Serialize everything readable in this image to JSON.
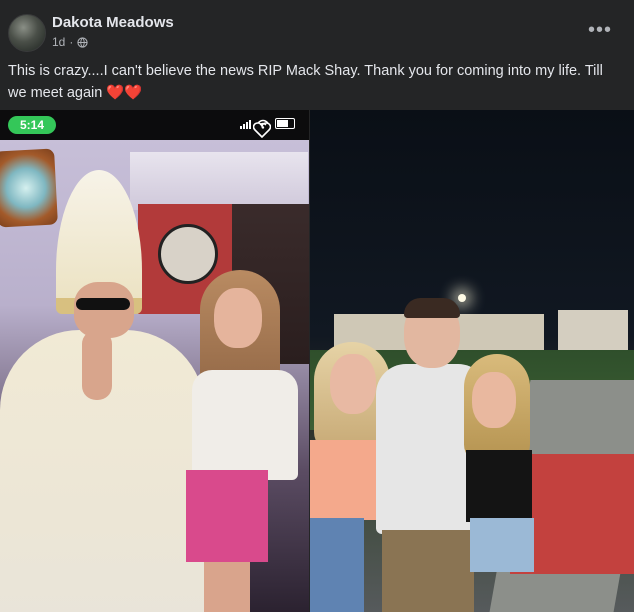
{
  "post": {
    "author": "Dakota Meadows",
    "time_ago": "1d",
    "separator": "·",
    "body": "This is crazy....I can't believe the news RIP Mack Shay. Thank you for coming into my life. Till we meet again",
    "emoji": "❤️❤️",
    "more_label": "•••"
  },
  "left_photo": {
    "status_time": "5:14"
  },
  "colors": {
    "card_bg": "#242526",
    "text_primary": "#e4e6eb",
    "text_secondary": "#b0b3b8",
    "time_pill": "#34c759",
    "heart": "#e0245e"
  },
  "icons": {
    "privacy": "globe-icon",
    "more": "more-options-icon",
    "signal": "signal-icon",
    "wifi": "wifi-icon",
    "battery": "battery-icon",
    "like_overlay": "heart-outline-icon"
  }
}
